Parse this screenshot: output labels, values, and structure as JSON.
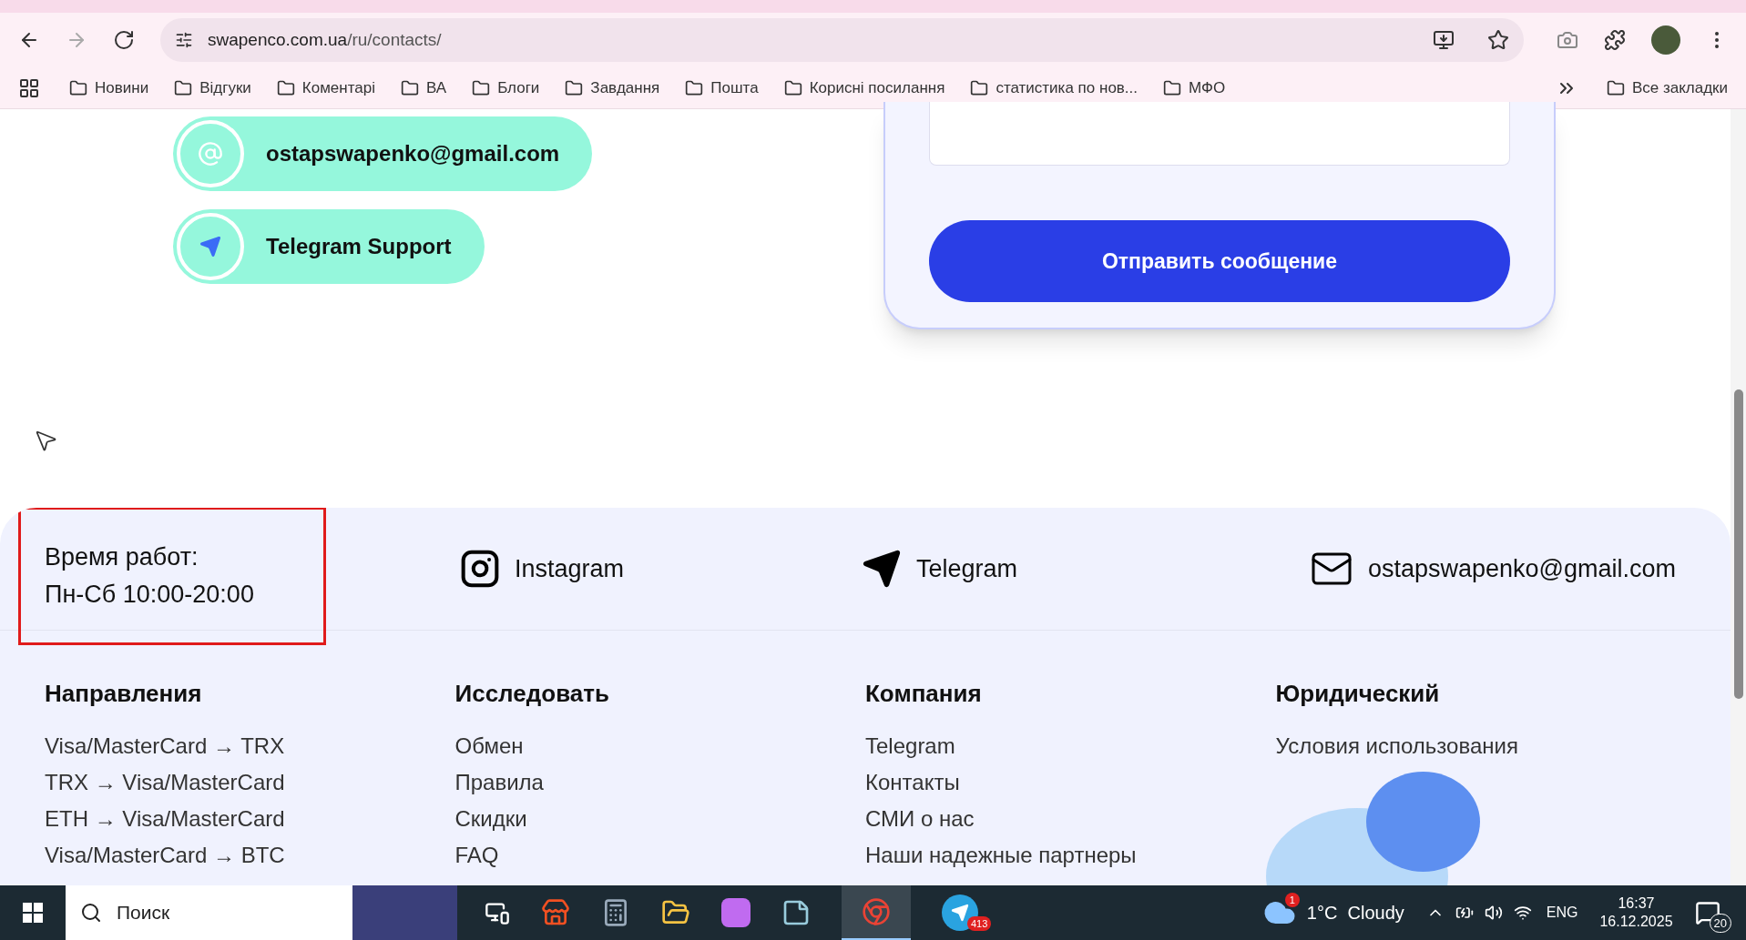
{
  "browser": {
    "url_host": "swapenco.com.ua",
    "url_path": "/ru/contacts/",
    "bookmarks": [
      "Новини",
      "Відгуки",
      "Коментарі",
      "ВА",
      "Блоги",
      "Завдання",
      "Пошта",
      "Корисні посилання",
      "статистика по нов...",
      "МФО"
    ],
    "all_bookmarks": "Все закладки"
  },
  "contacts": [
    {
      "kind": "email",
      "label": "ostapswapenko@gmail.com"
    },
    {
      "kind": "telegram",
      "label": "Telegram Support"
    }
  ],
  "form": {
    "submit": "Отправить сообщение"
  },
  "footer": {
    "hours": [
      "Время работ:",
      "Пн-Сб 10:00-20:00"
    ],
    "social": [
      {
        "kind": "instagram",
        "label": "Instagram"
      },
      {
        "kind": "telegram",
        "label": "Telegram"
      },
      {
        "kind": "email",
        "label": "ostapswapenko@gmail.com"
      }
    ],
    "columns": [
      {
        "title": "Направления",
        "links": [
          "Visa/MasterCard → TRX",
          "TRX → Visa/MasterCard",
          "ETH → Visa/MasterCard",
          "Visa/MasterCard → BTC"
        ]
      },
      {
        "title": "Исследовать",
        "links": [
          "Обмен",
          "Правила",
          "Скидки",
          "FAQ"
        ]
      },
      {
        "title": "Компания",
        "links": [
          "Telegram",
          "Контакты",
          "СМИ о нас",
          "Наши надежные партнеры"
        ]
      },
      {
        "title": "Юридический",
        "links": [
          "Условия использования"
        ]
      }
    ]
  },
  "taskbar": {
    "search_placeholder": "Поиск",
    "telegram_badge": "413",
    "weather_badge": "1",
    "weather": "1°C  Cloudy",
    "language": "ENG",
    "time": "16:37",
    "date": "16.12.2025",
    "notifications": "20"
  }
}
